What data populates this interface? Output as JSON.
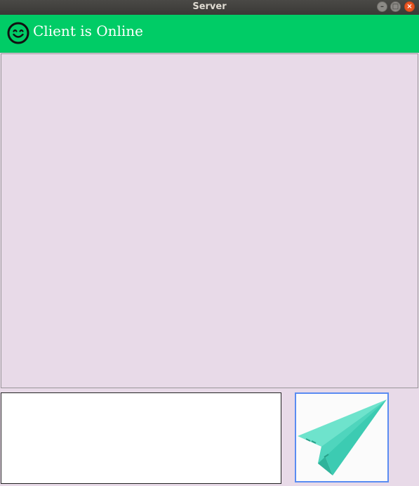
{
  "window": {
    "title": "Server",
    "controls": {
      "minimize_icon": "minimize-icon",
      "maximize_icon": "maximize-icon",
      "close_icon": "close-icon"
    }
  },
  "header": {
    "status_text": "Client is Online",
    "status_icon": "smiley-face-icon",
    "background_color": "#00cc66",
    "text_color": "#ffffff"
  },
  "chat": {
    "background_color": "#e8dae8"
  },
  "composer": {
    "message_value": "",
    "send_icon": "paper-plane-icon",
    "send_border_color": "#5a8cf2"
  }
}
